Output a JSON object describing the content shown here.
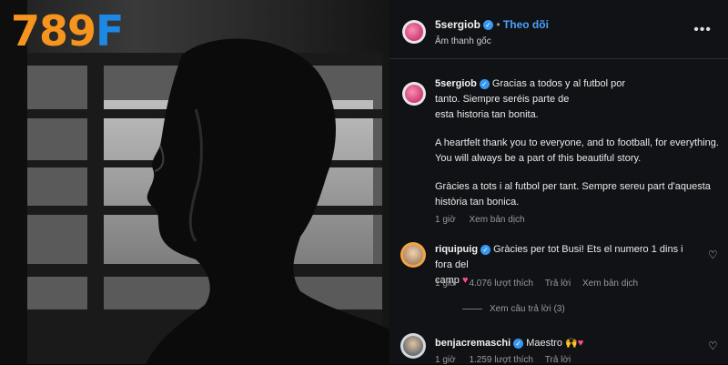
{
  "brand": {
    "logo_digits": "789",
    "logo_letter": "F"
  },
  "post": {
    "username": "5sergiob",
    "follow_label": "Theo dõi",
    "audio_label": "Âm thanh gốc",
    "caption_user": "5sergiob",
    "caption_lines_es": [
      "Gracias a todos y al futbol por",
      "tanto. Siempre seréis parte de",
      "esta historia tan bonita."
    ],
    "caption_lines_en": [
      "A heartfelt thank you to everyone, and to football, for everything.",
      "You will always be a part of this beautiful story."
    ],
    "caption_lines_ca": [
      "Gràcies a tots i al futbol per tant. Sempre sereu part d'aquesta",
      "història tan bonica."
    ],
    "time": "1 giờ",
    "see_translation": "Xem bản dịch"
  },
  "comments": [
    {
      "username": "riquipuig",
      "text_line1": "Gràcies per tot Busi! Ets el numero 1 dins i fora del",
      "text_line2": "camp",
      "emoji": "♥",
      "time": "1 giờ",
      "likes": "4.076 lượt thích",
      "reply": "Trả lời",
      "see_translation": "Xem bản dịch",
      "view_replies": "Xem câu trả lời (3)"
    },
    {
      "username": "benjacremaschi",
      "text": "Maestro",
      "emoji": "🙌♥",
      "time": "1 giờ",
      "likes": "1.259 lượt thích",
      "reply": "Trả lời"
    }
  ],
  "icons": {
    "more": "more-options-icon",
    "like": "heart-icon",
    "verified": "verified-badge-icon"
  },
  "colors": {
    "logo_orange": "#f7941d",
    "logo_blue": "#1e88e5",
    "link_blue": "#4aa3ff",
    "verified_blue": "#3897f0",
    "panel_bg": "#101215"
  }
}
